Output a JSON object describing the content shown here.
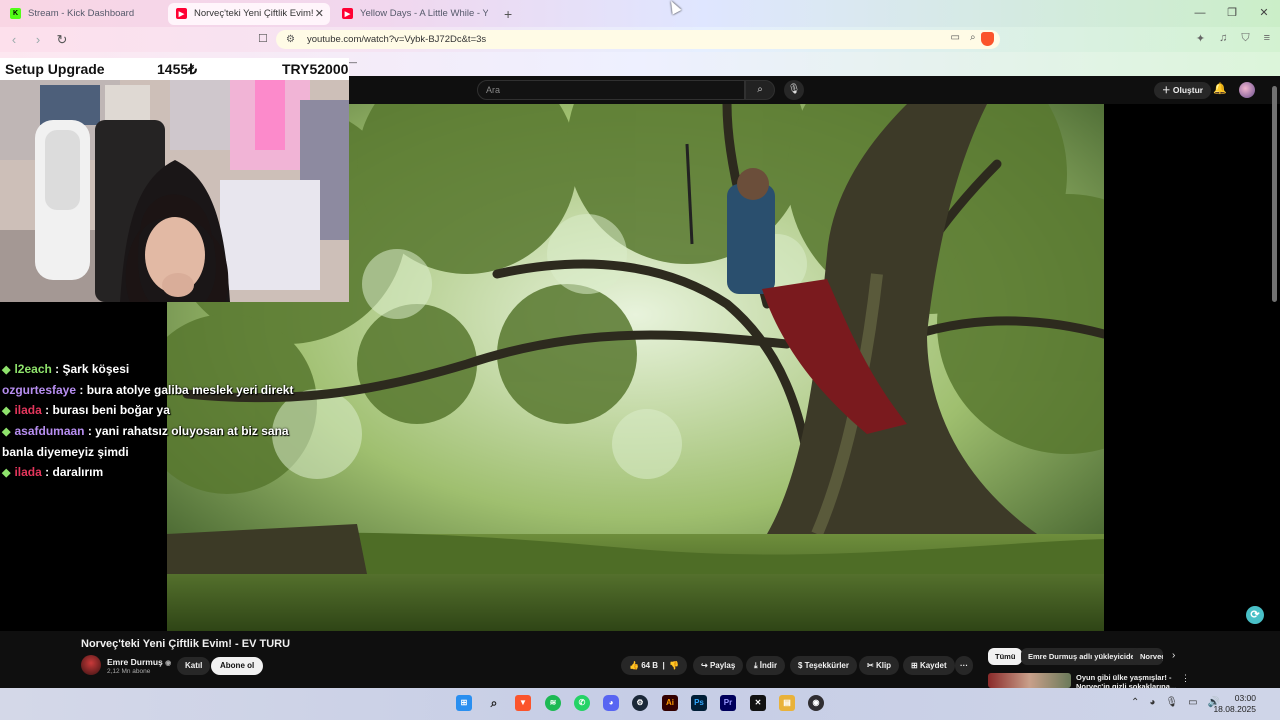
{
  "browser": {
    "tabs": [
      {
        "title": "Stream - Kick Dashboard",
        "favicon": "kick-icon",
        "favicon_color": "#53fc18",
        "active": false
      },
      {
        "title": "Norveç'teki Yeni Çiftlik Evim! - EV TURU - YouTube",
        "favicon": "youtube-icon",
        "favicon_color": "#ff0033",
        "active": true
      },
      {
        "title": "Yellow Days - A Little While - YouTube",
        "favicon": "youtube-icon",
        "favicon_color": "#ff0033",
        "active": false
      }
    ],
    "new_tab": "+",
    "url": "youtube.com/watch?v=Vybk-BJ72Dc&t=3s",
    "window_controls": {
      "minimize": "—",
      "maximize": "❐",
      "close": "✕"
    }
  },
  "overlay": {
    "goal_label": "Setup Upgrade",
    "amount": "1455₺",
    "target": "TRY52000"
  },
  "youtube": {
    "header": {
      "search_placeholder": "Ara",
      "create_label": "Oluştur"
    },
    "video": {
      "title": "Norveç'teki Yeni Çiftlik Evim! - EV TURU"
    },
    "channel": {
      "name": "Emre Durmuş",
      "verified": "◉",
      "subscribers": "2,12 Mn abone",
      "join_label": "Katıl",
      "subscribe_label": "Abone ol"
    },
    "actions": {
      "likes": "64 B",
      "share": "Paylaş",
      "download": "İndir",
      "thanks": "Teşekkürler",
      "clip": "Klip",
      "save": "Kaydet",
      "more": "···"
    },
    "chips": [
      {
        "label": "Tümü",
        "selected": true
      },
      {
        "label": "Emre Durmuş adlı yükleyiciden",
        "selected": false
      },
      {
        "label": "Norveç",
        "selected": false
      }
    ],
    "recommended": {
      "title_line1": "Oyun gibi ülke yaşmışlar! -",
      "title_line2": "Norveç'in gizli sokaklarına..."
    }
  },
  "chat": [
    {
      "user": "l2each",
      "user_color": "#8fe36c",
      "badge": true,
      "message": "Şark köşesi"
    },
    {
      "user": "ozgurtesfaye",
      "user_color": "#b78ef0",
      "badge": false,
      "message": "bura atolye galiba meslek yeri direkt"
    },
    {
      "user": "ilada",
      "user_color": "#e3365c",
      "badge": true,
      "message": "burası beni boğar ya"
    },
    {
      "user": "asafdumaan",
      "user_color": "#b78ef0",
      "badge": true,
      "message": "yani rahatsız oluyosan at biz sana banla diyemeyiz şimdi"
    },
    {
      "user": "ilada",
      "user_color": "#e3365c",
      "badge": true,
      "message": "daralırım"
    }
  ],
  "taskbar": {
    "apps": [
      "windows-start-icon",
      "search-icon",
      "brave-icon",
      "spotify-icon",
      "whatsapp-icon",
      "discord-icon",
      "steam-icon",
      "illustrator-icon",
      "photoshop-icon",
      "premiere-icon",
      "capcut-icon",
      "files-icon",
      "obs-icon"
    ],
    "time": "03:00",
    "date": "18.08.2025"
  }
}
